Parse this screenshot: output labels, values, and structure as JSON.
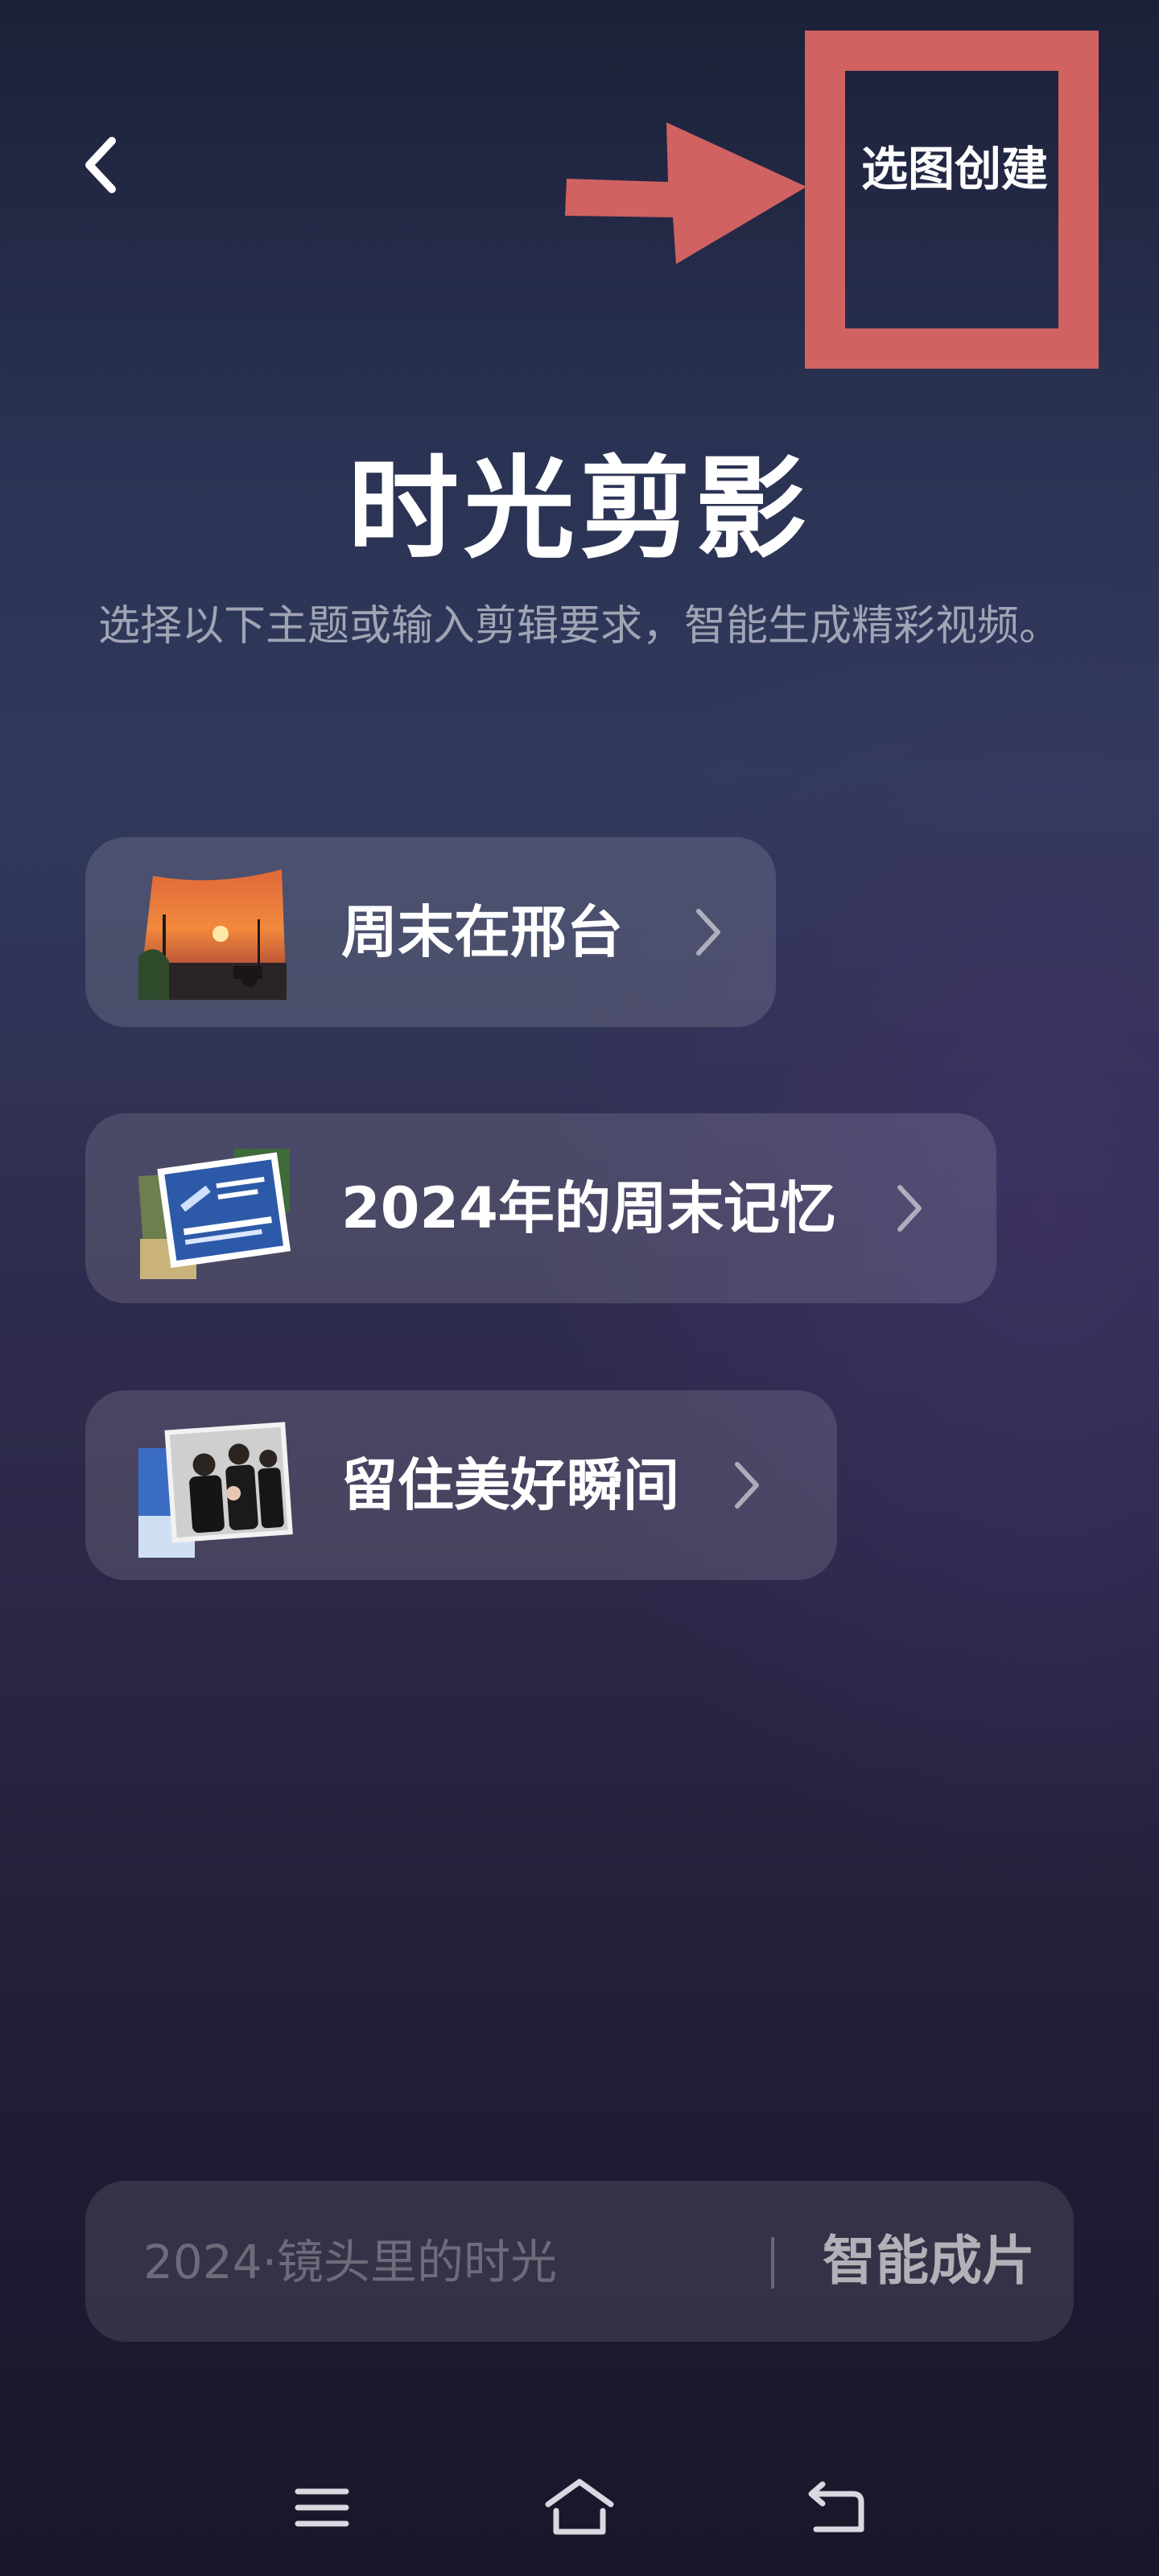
{
  "header": {
    "back_icon": "chevron-left-icon",
    "create_label": "选图创建"
  },
  "title": "时光剪影",
  "subtitle": "选择以下主题或输入剪辑要求，智能生成精彩视频。",
  "topics": [
    {
      "label": "周末在邢台",
      "thumb": "sunset-photo-thumbnail",
      "chevron": "chevron-right-icon"
    },
    {
      "label": "2024年的周末记忆",
      "thumb": "collage-photo-thumbnail",
      "chevron": "chevron-right-icon"
    },
    {
      "label": "留住美好瞬间",
      "thumb": "family-photo-thumbnail",
      "chevron": "chevron-right-icon"
    }
  ],
  "prompt": {
    "placeholder": "2024·镜头里的时光",
    "value": "",
    "button_label": "智能成片"
  },
  "navbar": {
    "menu_icon": "menu-icon",
    "home_icon": "home-icon",
    "back_icon": "back-icon"
  },
  "annotation_color": "#d06262"
}
